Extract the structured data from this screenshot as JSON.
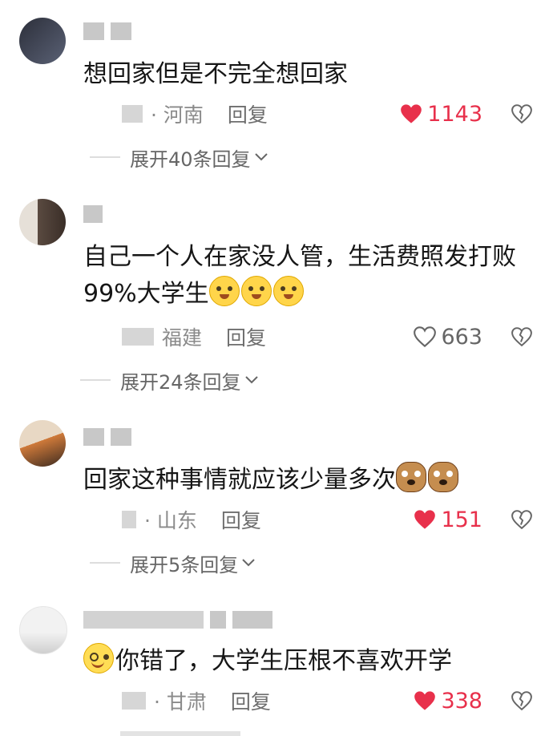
{
  "comments": [
    {
      "text": "想回家但是不完全想回家",
      "location": "· 河南",
      "reply_label": "回复",
      "likes": "1143",
      "liked": true,
      "expand_label": "展开40条回复"
    },
    {
      "text_line1": "自己一个人在家没人管，生活费照发打败",
      "text_line2": "99%大学生",
      "emojis": [
        "sweat-emoji",
        "sweat-emoji",
        "sweat-emoji"
      ],
      "location": "福建",
      "reply_label": "回复",
      "likes": "663",
      "liked": false,
      "expand_label": "展开24条回复"
    },
    {
      "text": "回家这种事情就应该少量多次",
      "emojis": [
        "dog-emoji",
        "dog-emoji"
      ],
      "location": "· 山东",
      "reply_label": "回复",
      "likes": "151",
      "liked": true,
      "expand_label": "展开5条回复"
    },
    {
      "text": "你错了，大学生压根不喜欢开学",
      "emojis": [
        "smile-emoji"
      ],
      "location": "· 甘肃",
      "reply_label": "回复",
      "likes": "338",
      "liked": true
    }
  ],
  "colors": {
    "liked_red": "#e8304b",
    "meta_gray": "#8a8a8a"
  },
  "icons": {
    "like": "heart-icon",
    "dislike": "broken-heart-icon",
    "expand": "chevron-down-icon"
  }
}
